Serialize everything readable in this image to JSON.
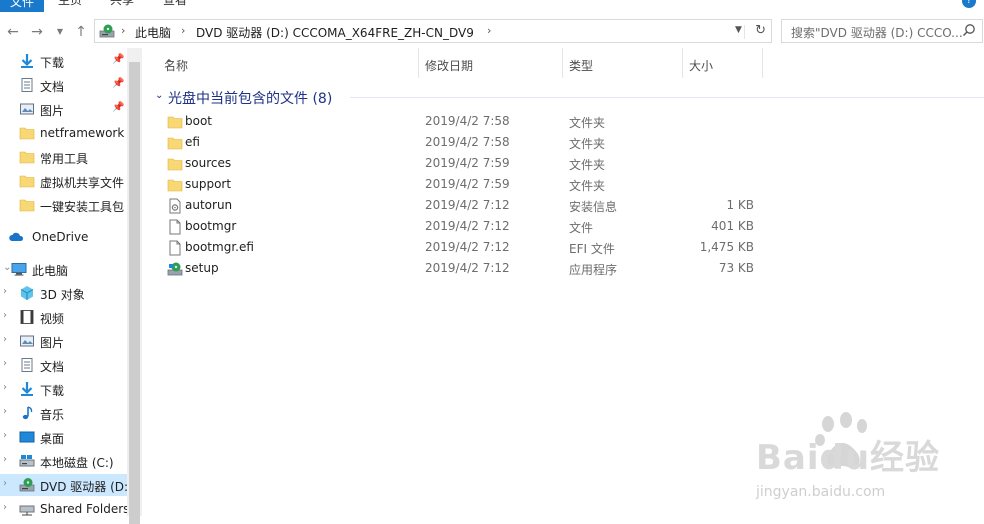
{
  "ribbon": {
    "tabs": [
      "文件",
      "主页",
      "共享",
      "查看"
    ]
  },
  "address": {
    "crumbs": [
      "此电脑",
      "DVD 驱动器 (D:) CCCOMA_X64FRE_ZH-CN_DV9"
    ]
  },
  "search": {
    "placeholder": "搜索\"DVD 驱动器 (D:) CCCO..."
  },
  "nav": {
    "quick_access": [
      {
        "label": "下载",
        "icon": "download-icon",
        "pinned": true
      },
      {
        "label": "文档",
        "icon": "document-icon",
        "pinned": true
      },
      {
        "label": "图片",
        "icon": "picture-icon",
        "pinned": true
      },
      {
        "label": "netframework",
        "icon": "folder-icon"
      },
      {
        "label": "常用工具",
        "icon": "folder-icon"
      },
      {
        "label": "虚拟机共享文件",
        "icon": "folder-icon"
      },
      {
        "label": "一键安装工具包",
        "icon": "folder-icon"
      }
    ],
    "onedrive": "OneDrive",
    "this_pc": "此电脑",
    "pc_items": [
      {
        "label": "3D 对象",
        "icon": "cube-icon"
      },
      {
        "label": "视频",
        "icon": "video-icon"
      },
      {
        "label": "图片",
        "icon": "picture-icon"
      },
      {
        "label": "文档",
        "icon": "document-icon"
      },
      {
        "label": "下载",
        "icon": "download-icon"
      },
      {
        "label": "音乐",
        "icon": "music-icon"
      },
      {
        "label": "桌面",
        "icon": "desktop-icon"
      },
      {
        "label": "本地磁盘 (C:)",
        "icon": "drive-icon"
      },
      {
        "label": "DVD 驱动器 (D:",
        "icon": "dvd-drive-icon",
        "selected": true
      },
      {
        "label": "Shared Folders",
        "icon": "network-drive-icon"
      }
    ]
  },
  "columns": [
    "名称",
    "修改日期",
    "类型",
    "大小"
  ],
  "group_title": "光盘中当前包含的文件 (8)",
  "files": [
    {
      "name": "boot",
      "date": "2019/4/2 7:58",
      "type": "文件夹",
      "size": "",
      "icon": "folder-icon"
    },
    {
      "name": "efi",
      "date": "2019/4/2 7:58",
      "type": "文件夹",
      "size": "",
      "icon": "folder-icon"
    },
    {
      "name": "sources",
      "date": "2019/4/2 7:59",
      "type": "文件夹",
      "size": "",
      "icon": "folder-icon"
    },
    {
      "name": "support",
      "date": "2019/4/2 7:59",
      "type": "文件夹",
      "size": "",
      "icon": "folder-icon"
    },
    {
      "name": "autorun",
      "date": "2019/4/2 7:12",
      "type": "安装信息",
      "size": "1 KB",
      "icon": "setup-info-icon"
    },
    {
      "name": "bootmgr",
      "date": "2019/4/2 7:12",
      "type": "文件",
      "size": "401 KB",
      "icon": "file-icon"
    },
    {
      "name": "bootmgr.efi",
      "date": "2019/4/2 7:12",
      "type": "EFI 文件",
      "size": "1,475 KB",
      "icon": "file-icon"
    },
    {
      "name": "setup",
      "date": "2019/4/2 7:12",
      "type": "应用程序",
      "size": "73 KB",
      "icon": "setup-app-icon"
    }
  ],
  "watermark": {
    "brand": "Baidu经验",
    "url": "jingyan.baidu.com"
  },
  "colors": {
    "accent": "#1979ca",
    "selection": "#cce8ff",
    "group_title": "#1e3287",
    "folder": "#f8d775"
  }
}
